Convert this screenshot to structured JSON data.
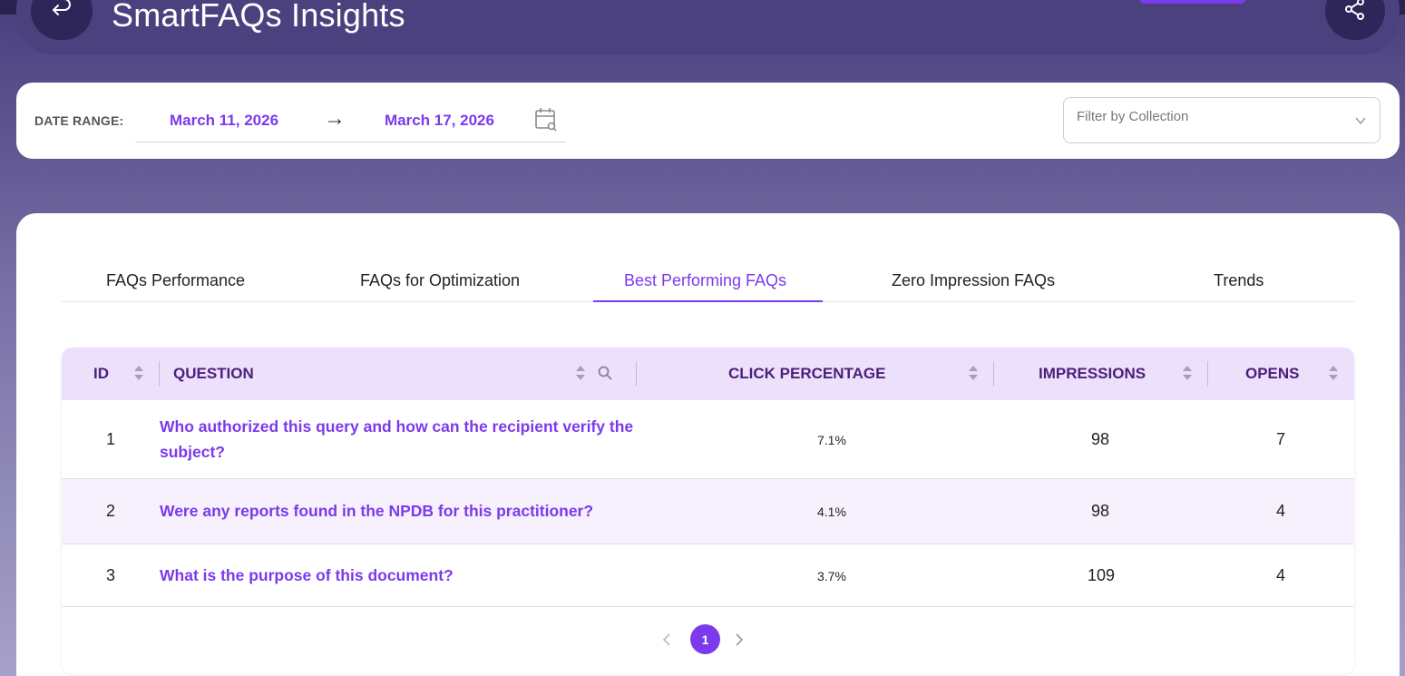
{
  "app": {
    "title": "SmartFAQs Insights"
  },
  "filters": {
    "date_range_label": "DATE RANGE:",
    "start_date": "March 11, 2026",
    "arrow": "→",
    "end_date": "March 17, 2026",
    "collection_placeholder": "Filter by Collection"
  },
  "tabs": [
    {
      "label": "FAQs Performance",
      "active": false
    },
    {
      "label": "FAQs for Optimization",
      "active": false
    },
    {
      "label": "Best Performing FAQs",
      "active": true
    },
    {
      "label": "Zero Impression FAQs",
      "active": false
    },
    {
      "label": "Trends",
      "active": false
    }
  ],
  "table": {
    "columns": [
      "ID",
      "QUESTION",
      "CLICK PERCENTAGE",
      "IMPRESSIONS",
      "OPENS"
    ],
    "rows": [
      {
        "id": "1",
        "question": "Who authorized this query and how can the recipient verify the subject?",
        "click_percentage": "7.1%",
        "impressions": "98",
        "opens": "7"
      },
      {
        "id": "2",
        "question": "Were any reports found in the NPDB for this practitioner?",
        "click_percentage": "4.1%",
        "impressions": "98",
        "opens": "4"
      },
      {
        "id": "3",
        "question": "What is the purpose of this document?",
        "click_percentage": "3.7%",
        "impressions": "109",
        "opens": "4"
      }
    ]
  },
  "pagination": {
    "current_page": "1"
  },
  "colors": {
    "accent": "#7c3aed",
    "header_bg": "#ece0fb",
    "header_text": "#4b1f7a"
  },
  "icons": {
    "back": "back-arrow-icon",
    "share": "share-icon",
    "calendar": "calendar-search-icon",
    "dropdown": "chevron-down-icon",
    "sort": "sort-icon",
    "search": "search-icon"
  }
}
